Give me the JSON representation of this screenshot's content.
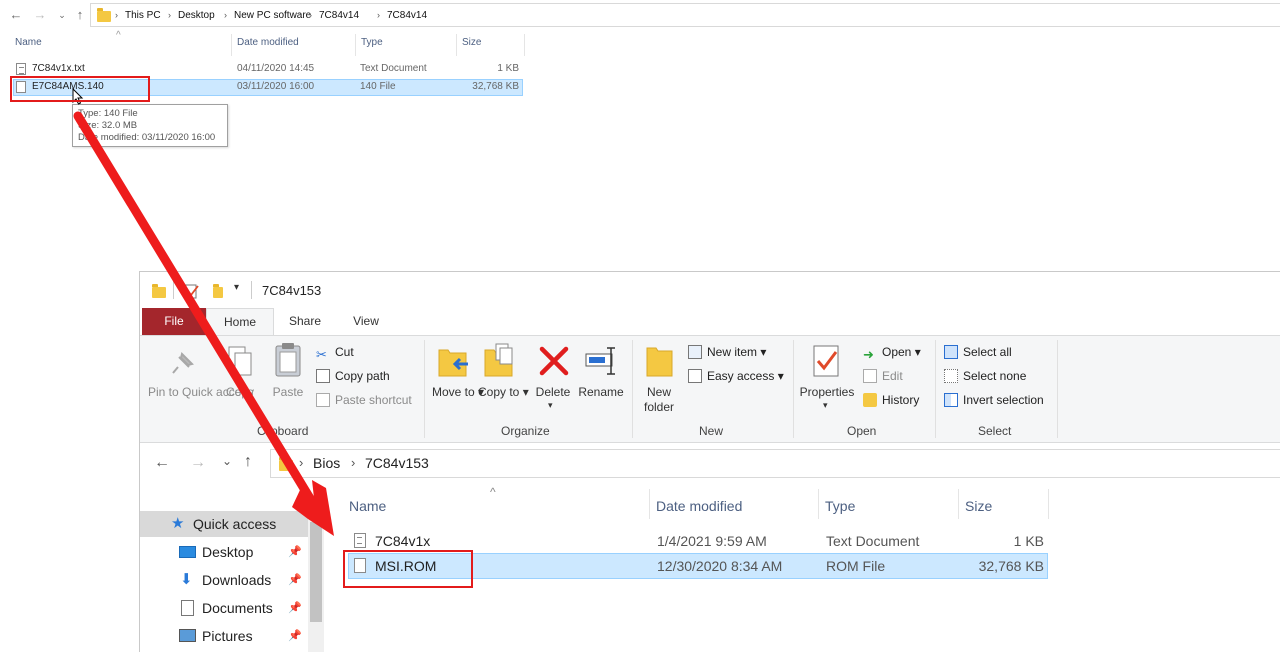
{
  "top_window": {
    "breadcrumbs": [
      "This PC",
      "Desktop",
      "New PC software",
      "7C84v14",
      "7C84v14"
    ],
    "columns": [
      "Name",
      "Date modified",
      "Type",
      "Size"
    ],
    "files": [
      {
        "name": "7C84v1x.txt",
        "date": "04/11/2020 14:45",
        "type": "Text Document",
        "size": "1 KB"
      },
      {
        "name": "E7C84AMS.140",
        "date": "03/11/2020 16:00",
        "type": "140 File",
        "size": "32,768 KB"
      }
    ],
    "tooltip": {
      "line1": "Type: 140 File",
      "line2": "Size: 32.0 MB",
      "line3": "Date modified: 03/11/2020 16:00"
    }
  },
  "bottom_window": {
    "title": "7C84v153",
    "tabs": {
      "file": "File",
      "home": "Home",
      "share": "Share",
      "view": "View"
    },
    "ribbon": {
      "clipboard": {
        "label": "Clipboard",
        "pin": "Pin to Quick access",
        "copy": "Copy",
        "paste": "Paste",
        "cut": "Cut",
        "copy_path": "Copy path",
        "paste_shortcut": "Paste shortcut"
      },
      "organize": {
        "label": "Organize",
        "move_to": "Move to",
        "copy_to": "Copy to",
        "delete": "Delete",
        "rename": "Rename"
      },
      "new": {
        "label": "New",
        "new_folder": "New folder",
        "new_item": "New item",
        "easy_access": "Easy access"
      },
      "open": {
        "label": "Open",
        "properties": "Properties",
        "open": "Open",
        "edit": "Edit",
        "history": "History"
      },
      "select": {
        "label": "Select",
        "select_all": "Select all",
        "select_none": "Select none",
        "invert": "Invert selection"
      }
    },
    "breadcrumbs": [
      "Bios",
      "7C84v153"
    ],
    "nav_items": [
      {
        "label": "Quick access",
        "icon": "star-icon"
      },
      {
        "label": "Desktop",
        "icon": "desktop-icon"
      },
      {
        "label": "Downloads",
        "icon": "download-icon"
      },
      {
        "label": "Documents",
        "icon": "documents-icon"
      },
      {
        "label": "Pictures",
        "icon": "pictures-icon"
      }
    ],
    "columns": [
      "Name",
      "Date modified",
      "Type",
      "Size"
    ],
    "files": [
      {
        "name": "7C84v1x",
        "date": "1/4/2021 9:59 AM",
        "type": "Text Document",
        "size": "1 KB"
      },
      {
        "name": "MSI.ROM",
        "date": "12/30/2020 8:34 AM",
        "type": "ROM File",
        "size": "32,768 KB"
      }
    ]
  },
  "annotation_color": "#e31b1b",
  "selection_color": "#cce8ff"
}
